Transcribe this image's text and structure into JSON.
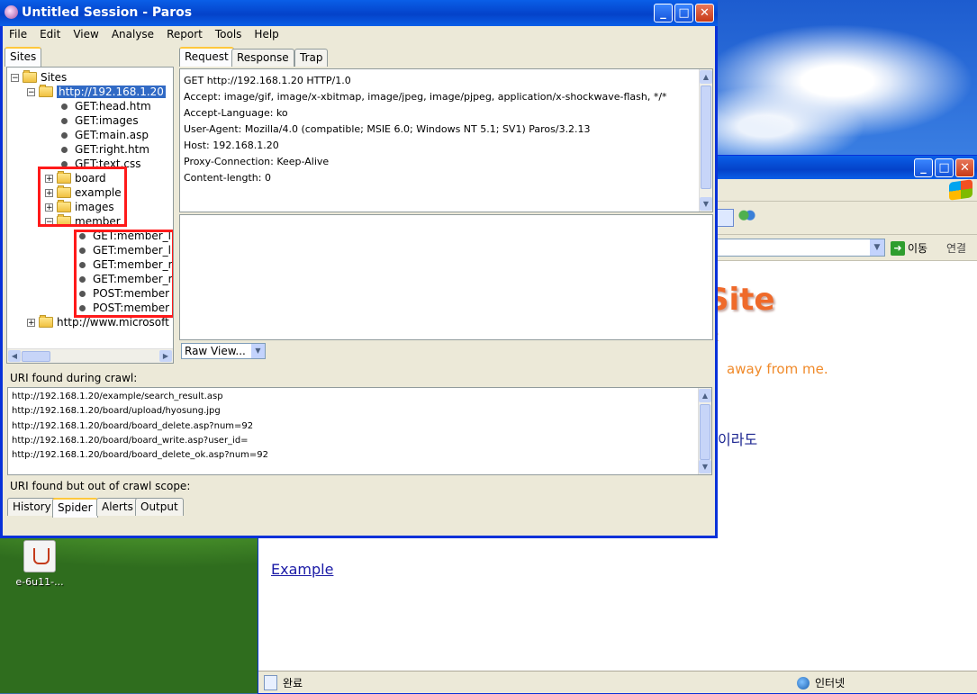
{
  "paros": {
    "title": "Untitled Session - Paros",
    "menu": [
      "File",
      "Edit",
      "View",
      "Analyse",
      "Report",
      "Tools",
      "Help"
    ],
    "sites_tab": "Sites",
    "tree": {
      "root": "Sites",
      "host1": "http://192.168.1.20",
      "files": [
        "GET:head.htm",
        "GET:images",
        "GET:main.asp",
        "GET:right.htm",
        "GET:text.css"
      ],
      "folders": [
        "board",
        "example",
        "images",
        "member"
      ],
      "member_items": [
        "GET:member_l",
        "GET:member_l",
        "GET:member_r",
        "GET:member_r",
        "POST:member",
        "POST:member"
      ],
      "host2": "http://www.microsoft"
    },
    "request_tabs": [
      "Request",
      "Response",
      "Trap"
    ],
    "request_lines": [
      "GET http://192.168.1.20 HTTP/1.0",
      "Accept: image/gif, image/x-xbitmap, image/jpeg, image/pjpeg, application/x-shockwave-flash, */*",
      "Accept-Language: ko",
      "User-Agent: Mozilla/4.0 (compatible; MSIE 6.0; Windows NT 5.1; SV1) Paros/3.2.13",
      "Host: 192.168.1.20",
      "Proxy-Connection: Keep-Alive",
      "Content-length: 0"
    ],
    "raw_view": "Raw View...",
    "uri_found_label": "URI found during crawl:",
    "uri_found": [
      "http://192.168.1.20/example/search_result.asp",
      "http://192.168.1.20/board/upload/hyosung.jpg",
      "http://192.168.1.20/board/board_delete.asp?num=92",
      "http://192.168.1.20/board/board_write.asp?user_id=",
      "http://192.168.1.20/board/board_delete_ok.asp?num=92"
    ],
    "out_of_scope_label": "URI found but out of crawl scope:",
    "bottom_tabs": [
      "History",
      "Spider",
      "Alerts",
      "Output"
    ],
    "active_bottom_tab": "Spider"
  },
  "ie": {
    "go_label": "이동",
    "links_label": "연결",
    "site_title": "Site",
    "orange_t": "t",
    "orange_text": "away from me.",
    "navy_text": "이라도",
    "example_link": "Example",
    "status_left": "완료",
    "status_right": "인터넷"
  },
  "desktop": {
    "icon_label": "e-6u11-..."
  }
}
